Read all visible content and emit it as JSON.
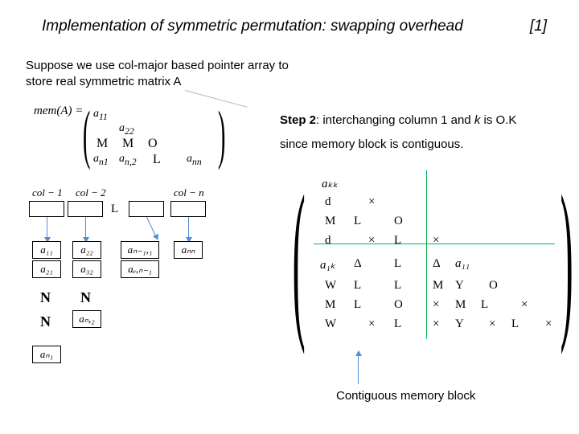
{
  "title": "Implementation of symmetric permutation: swapping overhead",
  "slide_no": "[1]",
  "intro": "Suppose we use col-major based pointer array to store real symmetric matrix A",
  "mem_label": "mem(A) =",
  "mem_entries": {
    "a11": "a",
    "a11s": "11",
    "a22": "a",
    "a22s": "22",
    "an1": "a",
    "an1s": "n1",
    "an2": "a",
    "an2s": "n,2",
    "ann": "a",
    "anns": "nn"
  },
  "cols": {
    "c1": "col − 1",
    "c2": "col − 2",
    "cn": "col − n"
  },
  "letterL": "L",
  "cells": {
    "c11": "a₁₁",
    "c21": "a₂₁",
    "c22": "a₂₂",
    "c32": "a₃₂",
    "cn1": "aₙ₁",
    "cn2": "aₙ,₂",
    "cnn": "aₙₙ",
    "cn11": "aₙ₋₁,₁",
    "cen": "aₑ,ₙ₋₁"
  },
  "M": "M",
  "O": "O",
  "L": "L",
  "step2": "Step 2",
  "step2_rest": ": interchanging column 1 and",
  "kital": " k ",
  "step2_tail": "is O.K",
  "step2_line2": "since memory block is contiguous.",
  "matrix": {
    "akk": "aₖₖ",
    "d1": "d",
    "x": "×",
    "d2": "d",
    "a1k": "a₁ₖ",
    "a11": "a₁₁",
    "delta": "Δ",
    "W": "W",
    "Y": "Y"
  },
  "contiguous": "Contiguous memory block"
}
